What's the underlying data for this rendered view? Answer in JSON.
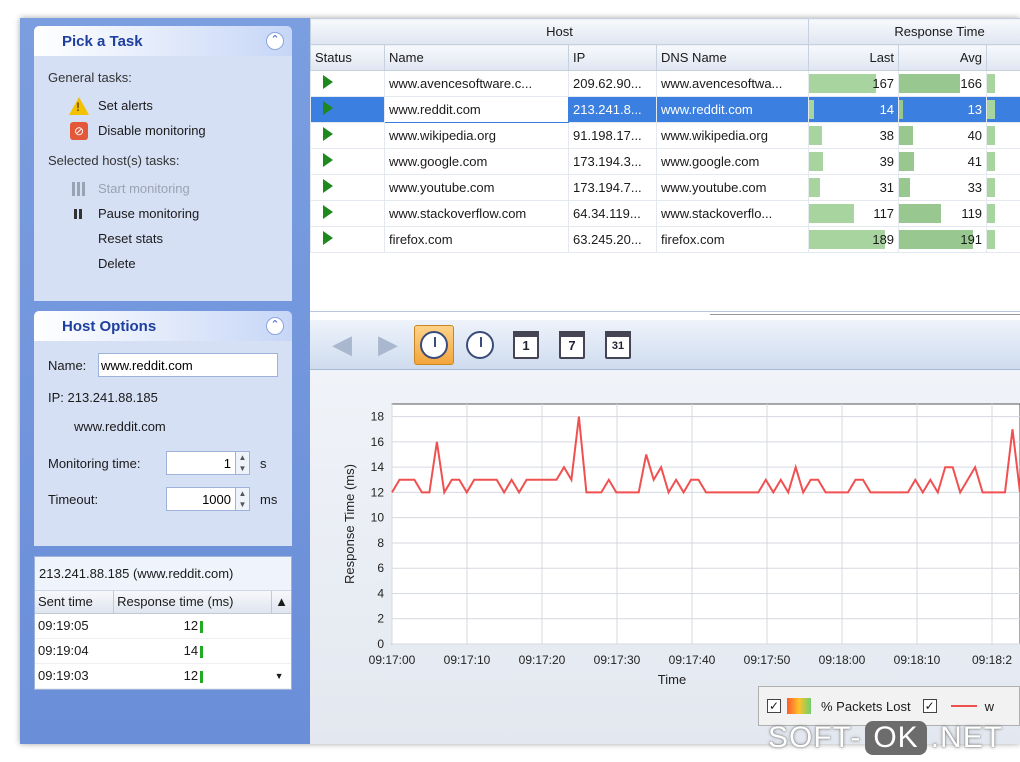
{
  "colors": {
    "accent": "#3b7fe0",
    "task_pane": "#6a8ed8",
    "series_line": "#f05050",
    "bar_fill": "#a8d4a0",
    "running": "#1e8a1e"
  },
  "tasks_panel": {
    "title": "Pick a Task",
    "general_label": "General tasks:",
    "general": [
      {
        "label": "Set alerts",
        "icon": "warning-icon"
      },
      {
        "label": "Disable monitoring",
        "icon": "stop-icon"
      }
    ],
    "selected_label": "Selected host(s) tasks:",
    "selected": [
      {
        "label": "Start monitoring",
        "icon": "bars-icon",
        "disabled": true
      },
      {
        "label": "Pause monitoring",
        "icon": "pause-icon",
        "disabled": false
      },
      {
        "label": "Reset stats",
        "icon": "",
        "disabled": false
      },
      {
        "label": "Delete",
        "icon": "",
        "disabled": false
      }
    ]
  },
  "host_options": {
    "title": "Host Options",
    "name_label": "Name:",
    "name_value": "www.reddit.com",
    "ip_text": "IP: 213.241.88.185",
    "dns_text": "www.reddit.com",
    "monitoring_label": "Monitoring time:",
    "monitoring_value": "1",
    "monitoring_unit": "s",
    "timeout_label": "Timeout:",
    "timeout_value": "1000",
    "timeout_unit": "ms"
  },
  "history": {
    "title": "213.241.88.185 (www.reddit.com)",
    "headers": [
      "Sent time",
      "Response time (ms)"
    ],
    "rows": [
      {
        "time": "09:19:05",
        "value": "12"
      },
      {
        "time": "09:19:04",
        "value": "14"
      },
      {
        "time": "09:19:03",
        "value": "12"
      }
    ]
  },
  "hosts": {
    "group_host": "Host",
    "group_response": "Response Time",
    "headers": {
      "status": "Status",
      "name": "Name",
      "ip": "IP",
      "dns": "DNS Name",
      "last": "Last",
      "avg": "Avg"
    },
    "rows": [
      {
        "name": "www.avencesoftware.c...",
        "ip": "209.62.90...",
        "dns": "www.avencesoftwa...",
        "last": "167",
        "avg": "166",
        "last_frac": 0.75,
        "avg_frac": 0.7
      },
      {
        "name": "www.reddit.com",
        "ip": "213.241.8...",
        "dns": "www.reddit.com",
        "last": "14",
        "avg": "13",
        "last_frac": 0.06,
        "avg_frac": 0.05,
        "selected": true
      },
      {
        "name": "www.wikipedia.org",
        "ip": "91.198.17...",
        "dns": "www.wikipedia.org",
        "last": "38",
        "avg": "40",
        "last_frac": 0.15,
        "avg_frac": 0.16
      },
      {
        "name": "www.google.com",
        "ip": "173.194.3...",
        "dns": "www.google.com",
        "last": "39",
        "avg": "41",
        "last_frac": 0.16,
        "avg_frac": 0.17
      },
      {
        "name": "www.youtube.com",
        "ip": "173.194.7...",
        "dns": "www.youtube.com",
        "last": "31",
        "avg": "33",
        "last_frac": 0.12,
        "avg_frac": 0.13
      },
      {
        "name": "www.stackoverflow.com",
        "ip": "64.34.119...",
        "dns": "www.stackoverflo...",
        "last": "117",
        "avg": "119",
        "last_frac": 0.5,
        "avg_frac": 0.48
      },
      {
        "name": "firefox.com",
        "ip": "63.245.20...",
        "dns": "firefox.com",
        "last": "189",
        "avg": "191",
        "last_frac": 0.85,
        "avg_frac": 0.85
      }
    ]
  },
  "toolbar": {
    "buttons": [
      {
        "name": "back-button",
        "icon": "back-arrow-icon"
      },
      {
        "name": "forward-button",
        "icon": "forward-arrow-icon"
      },
      {
        "name": "realtime-button",
        "icon": "clock-icon",
        "active": true
      },
      {
        "name": "history-button",
        "icon": "clock-icon"
      },
      {
        "name": "day-view-button",
        "icon": "calendar-icon",
        "label": "1"
      },
      {
        "name": "week-view-button",
        "icon": "calendar-icon",
        "label": "7"
      },
      {
        "name": "month-view-button",
        "icon": "calendar-icon",
        "label": "31"
      }
    ]
  },
  "legend": {
    "packets_lost": "% Packets Lost",
    "series_truncated": "w"
  },
  "watermark": {
    "left": "SOFT-",
    "pill": "OK",
    "right": ".NET"
  },
  "chart_data": {
    "type": "line",
    "ylabel": "Response Time (ms)",
    "xlabel": "Time",
    "ylim": [
      0,
      19
    ],
    "yticks": [
      0,
      2,
      4,
      6,
      8,
      10,
      12,
      14,
      16,
      18
    ],
    "xticks": [
      "09:17:00",
      "09:17:10",
      "09:17:20",
      "09:17:30",
      "09:17:40",
      "09:17:50",
      "09:18:00",
      "09:18:10",
      "09:18:2"
    ],
    "grid": true,
    "series": [
      {
        "name": "",
        "values": [
          12,
          13,
          13,
          13,
          12,
          12,
          16,
          12,
          13,
          13,
          12,
          13,
          13,
          13,
          13,
          12,
          13,
          12,
          13,
          13,
          13,
          13,
          13,
          14,
          13,
          18,
          12,
          12,
          12,
          13,
          12,
          12,
          12,
          12,
          15,
          13,
          14,
          12,
          13,
          12,
          13,
          13,
          12,
          12,
          12,
          12,
          12,
          12,
          12,
          12,
          13,
          12,
          13,
          12,
          14,
          12,
          13,
          13,
          12,
          12,
          12,
          12,
          13,
          13,
          12,
          12,
          12,
          12,
          12,
          12,
          13,
          12,
          13,
          12,
          14,
          14,
          12,
          13,
          14,
          12,
          12,
          12,
          12,
          17,
          12
        ]
      }
    ]
  }
}
